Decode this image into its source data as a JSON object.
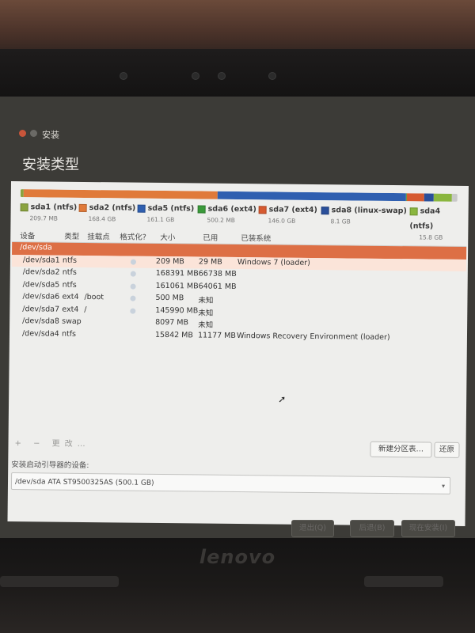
{
  "window": {
    "title": "安装",
    "page_title": "安装类型"
  },
  "partition_bar": [
    {
      "name": "sda1",
      "color": "#8aa33e",
      "share": 0.5
    },
    {
      "name": "sda2",
      "color": "#e07a3a",
      "share": 33
    },
    {
      "name": "sda5",
      "color": "#2f5fb0",
      "share": 32
    },
    {
      "name": "sda6",
      "color": "#3a9a3a",
      "share": 0.2
    },
    {
      "name": "sda7",
      "color": "#d65a30",
      "share": 3
    },
    {
      "name": "sda8",
      "color": "#2a4f9a",
      "share": 1.6
    },
    {
      "name": "sda4",
      "color": "#8ab63e",
      "share": 3
    },
    {
      "name": "free",
      "color": "#c8c8c8",
      "share": 1
    }
  ],
  "legend": [
    {
      "name": "sda1 (ntfs)",
      "size": "209.7 MB",
      "color": "#8aa33e"
    },
    {
      "name": "sda2 (ntfs)",
      "size": "168.4 GB",
      "color": "#e07a3a"
    },
    {
      "name": "sda5 (ntfs)",
      "size": "161.1 GB",
      "color": "#2f5fb0"
    },
    {
      "name": "sda6 (ext4)",
      "size": "500.2 MB",
      "color": "#3a9a3a"
    },
    {
      "name": "sda7 (ext4)",
      "size": "146.0 GB",
      "color": "#d65a30"
    },
    {
      "name": "sda8 (linux-swap)",
      "size": "8.1 GB",
      "color": "#2a4f9a"
    },
    {
      "name": "sda4 (ntfs)",
      "size": "15.8 GB",
      "color": "#8ab63e"
    }
  ],
  "table": {
    "headers": {
      "device": "设备",
      "type": "类型",
      "mount": "挂载点",
      "format": "格式化?",
      "size": "大小",
      "used": "已用",
      "system": "已装系统"
    },
    "rows": [
      {
        "device": "/dev/sda",
        "type": "",
        "mount": "",
        "size": "",
        "used": "",
        "system": "",
        "selected": true
      },
      {
        "device": "/dev/sda1",
        "type": "ntfs",
        "mount": "",
        "size": "209 MB",
        "used": "29 MB",
        "system": "Windows 7 (loader)"
      },
      {
        "device": "/dev/sda2",
        "type": "ntfs",
        "mount": "",
        "size": "168391 MB",
        "used": "66738 MB",
        "system": ""
      },
      {
        "device": "/dev/sda5",
        "type": "ntfs",
        "mount": "",
        "size": "161061 MB",
        "used": "64061 MB",
        "system": ""
      },
      {
        "device": "/dev/sda6",
        "type": "ext4",
        "mount": "/boot",
        "size": "500 MB",
        "used": "未知",
        "system": ""
      },
      {
        "device": "/dev/sda7",
        "type": "ext4",
        "mount": "/",
        "size": "145990 MB",
        "used": "未知",
        "system": ""
      },
      {
        "device": "/dev/sda8",
        "type": "swap",
        "mount": "",
        "size": "8097 MB",
        "used": "未知",
        "system": ""
      },
      {
        "device": "/dev/sda4",
        "type": "ntfs",
        "mount": "",
        "size": "15842 MB",
        "used": "11177 MB",
        "system": "Windows Recovery Environment (loader)"
      }
    ]
  },
  "toolbar": {
    "controls": "+ − 更改…",
    "new_table": "新建分区表…",
    "revert": "还原"
  },
  "boot_loader": {
    "label": "安装启动引导器的设备:",
    "value": "/dev/sda   ATA ST9500325AS (500.1 GB)"
  },
  "nav": {
    "quit": "退出(Q)",
    "back": "后退(B)",
    "install": "现在安装(I)"
  },
  "brand": "lenovo"
}
